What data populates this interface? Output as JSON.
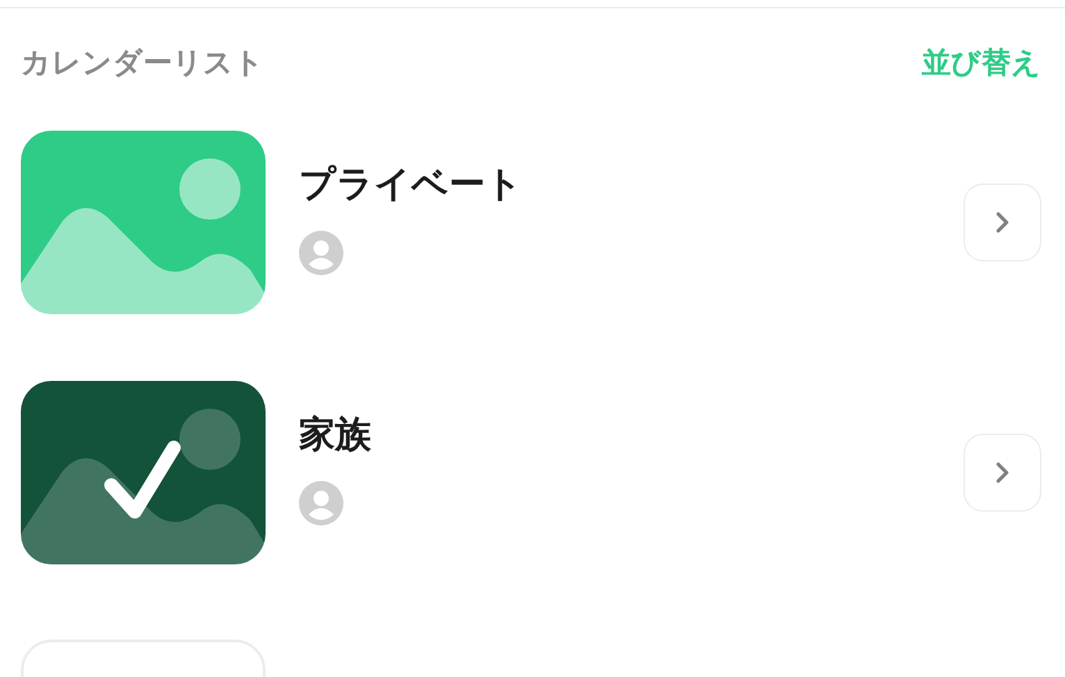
{
  "header": {
    "title": "カレンダーリスト",
    "sort_link": "並び替え"
  },
  "calendars": [
    {
      "name": "プライベート",
      "color": "#2ecc87",
      "selected": false
    },
    {
      "name": "家族",
      "color": "#13533a",
      "selected": true
    }
  ]
}
